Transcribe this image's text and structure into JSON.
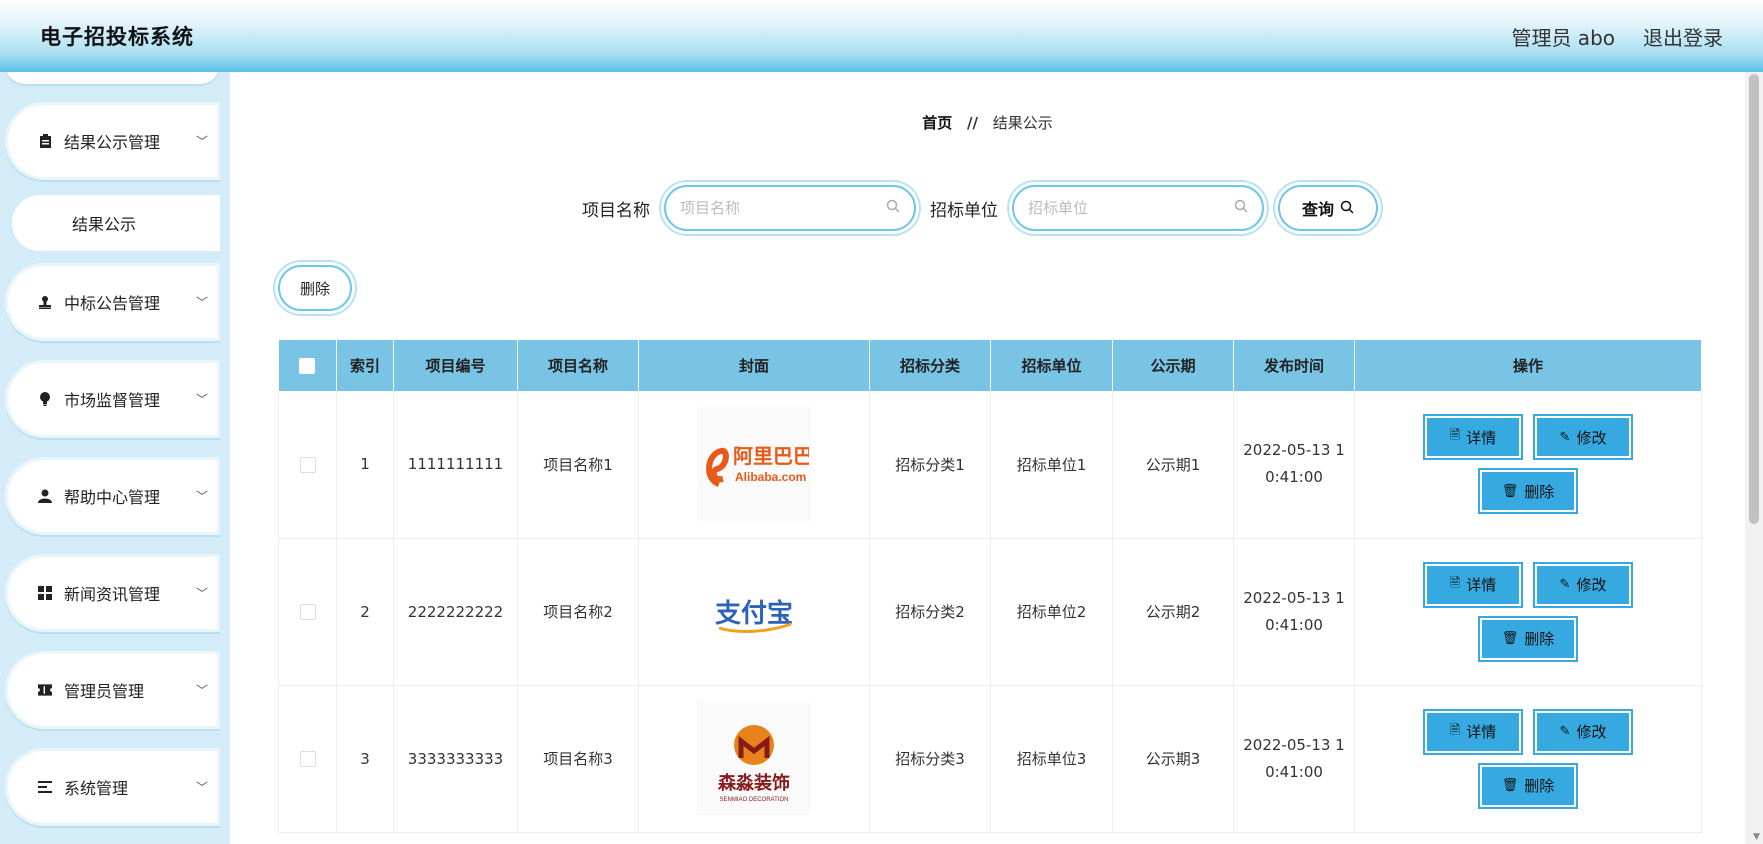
{
  "header": {
    "title": "电子招投标系统",
    "user": "管理员 abo",
    "logout": "退出登录"
  },
  "sidebar": {
    "items": [
      {
        "label": "结果公示管理",
        "icon": "clipboard-icon"
      },
      {
        "label": "中标公告管理",
        "icon": "stamp-icon"
      },
      {
        "label": "市场监督管理",
        "icon": "bulb-icon"
      },
      {
        "label": "帮助中心管理",
        "icon": "user-icon"
      },
      {
        "label": "新闻资讯管理",
        "icon": "grid-icon"
      },
      {
        "label": "管理员管理",
        "icon": "ticket-icon"
      },
      {
        "label": "系统管理",
        "icon": "list-icon"
      }
    ],
    "active_sub": "结果公示"
  },
  "breadcrumb": {
    "home": "首页",
    "sep": "//",
    "current": "结果公示"
  },
  "search": {
    "project_label": "项目名称",
    "project_placeholder": "项目名称",
    "unit_label": "招标单位",
    "unit_placeholder": "招标单位",
    "query_label": "查询"
  },
  "delete_label": "删除",
  "table": {
    "headers": [
      "索引",
      "项目编号",
      "项目名称",
      "封面",
      "招标分类",
      "招标单位",
      "公示期",
      "发布时间",
      "操作"
    ],
    "rows": [
      {
        "index": "1",
        "code": "1111111111",
        "name": "项目名称1",
        "cover": "Alibaba.com",
        "category": "招标分类1",
        "unit": "招标单位1",
        "period": "公示期1",
        "time1": "2022-05-13 1",
        "time2": "0:41:00"
      },
      {
        "index": "2",
        "code": "2222222222",
        "name": "项目名称2",
        "cover": "支付宝",
        "category": "招标分类2",
        "unit": "招标单位2",
        "period": "公示期2",
        "time1": "2022-05-13 1",
        "time2": "0:41:00"
      },
      {
        "index": "3",
        "code": "3333333333",
        "name": "项目名称3",
        "cover": "森淼装饰",
        "category": "招标分类3",
        "unit": "招标单位3",
        "period": "公示期3",
        "time1": "2022-05-13 1",
        "time2": "0:41:00"
      }
    ],
    "ops": {
      "detail": "详情",
      "edit": "修改",
      "delete": "删除"
    }
  },
  "colors": {
    "accent": "#36a9e1",
    "header_bg": "#79c4e4",
    "sidebar_bg": "#d3ecf7"
  }
}
